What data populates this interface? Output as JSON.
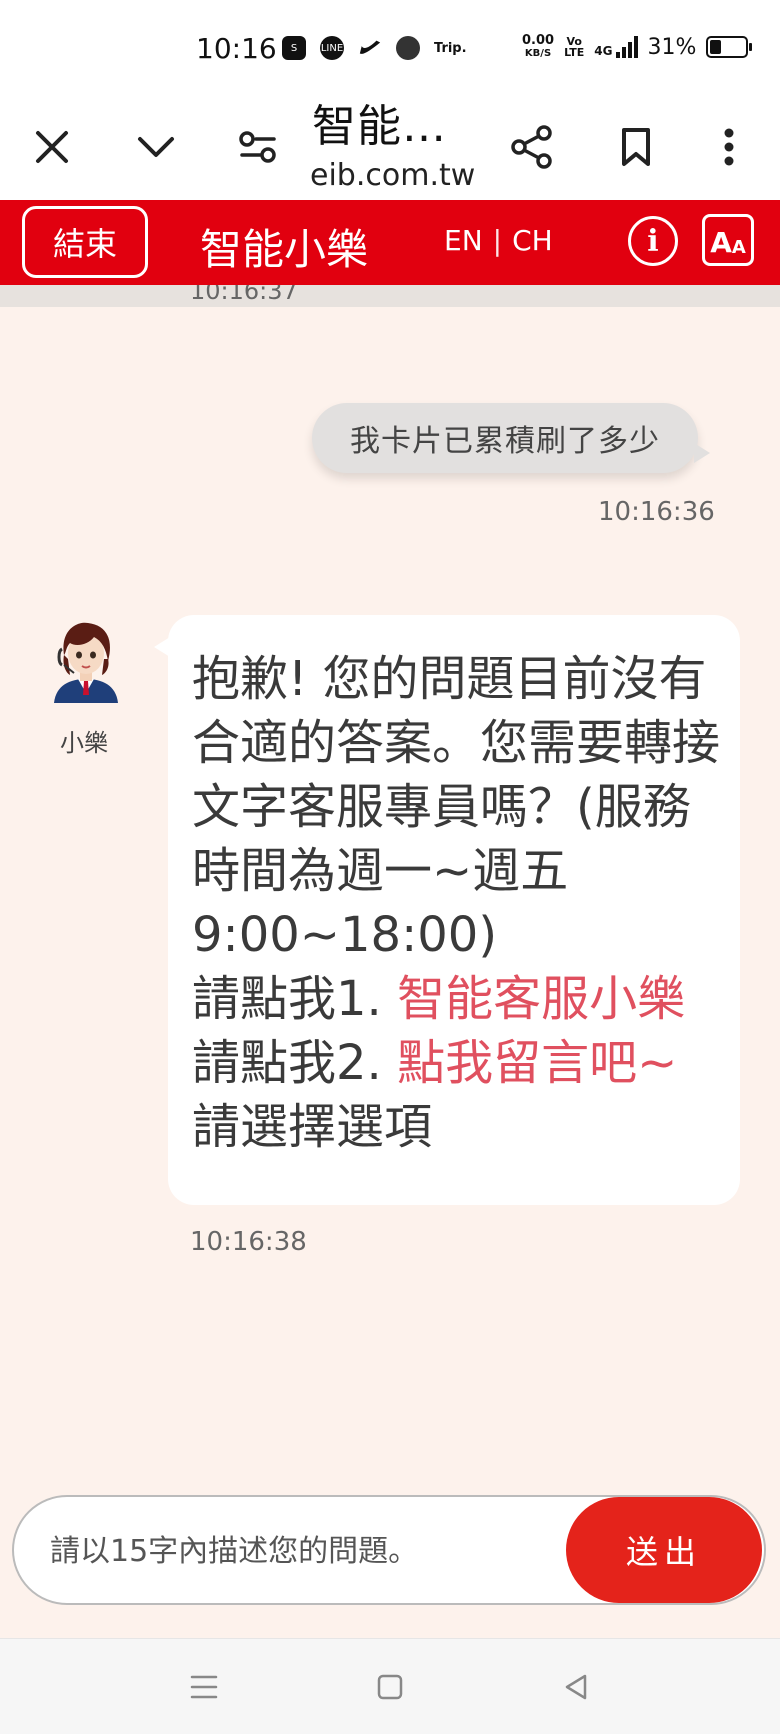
{
  "status_bar": {
    "time": "10:16",
    "app_icons": [
      "shopping-bag-icon",
      "line-icon",
      "nike-icon",
      "wallet-icon",
      "trip-icon"
    ],
    "trip_label": "Trip.",
    "net_speed_value": "0.00",
    "net_speed_unit": "KB/S",
    "volte_line1": "Vo",
    "volte_line2": "LTE",
    "network": "4G",
    "battery": "31%",
    "battery_level": 0.31
  },
  "browser": {
    "title": "智能…",
    "url": "eib.com.tw"
  },
  "header": {
    "end_label": "結束",
    "bot_name": "智能小樂",
    "lang_en": "EN",
    "lang_sep": "|",
    "lang_ch": "CH",
    "info_label": "i",
    "font_big": "A",
    "font_small": "A",
    "bg_color": "#e1000f"
  },
  "chat": {
    "prev_time_partial": "10:16:37",
    "user_message": "我卡片已累積刷了多少",
    "user_time": "10:16:36",
    "bot_name": "小樂",
    "bot_text1": "抱歉! 您的問題目前沒有合適的答案。您需要轉接文字客服專員嗎？(服務時間為週一~週五9:00~18:00)",
    "bot_option1_prefix": "請點我1. ",
    "bot_option1_link": "智能客服小樂",
    "bot_option2_prefix": "請點我2. ",
    "bot_option2_link": "點我留言吧~",
    "bot_prompt": "請選擇選項",
    "bot_time": "10:16:38",
    "link_color": "#e0505f",
    "bg_color": "#fdf2ec"
  },
  "input": {
    "placeholder": "請以15字內描述您的問題。",
    "value": "",
    "send_label": "送出",
    "send_color": "#e4231b"
  },
  "nav": {
    "icons": [
      "menu-icon",
      "home-square-icon",
      "back-triangle-icon"
    ]
  }
}
